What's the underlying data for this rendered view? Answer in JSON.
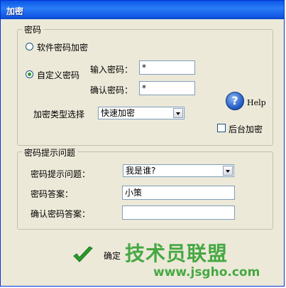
{
  "window": {
    "title": "加密"
  },
  "password_group": {
    "legend": "密码",
    "option_software": "软件密码加密",
    "option_custom": "自定义密码",
    "enter_password_label": "输入密码：",
    "enter_password_value": "*",
    "confirm_password_label": "确认密码：",
    "confirm_password_value": "*",
    "encrypt_type_label": "加密类型选择",
    "encrypt_type_value": "快速加密",
    "help_label": "Help",
    "background_encrypt_label": "后台加密"
  },
  "hint_group": {
    "legend": "密码提示问题",
    "question_label": "密码提示问题：",
    "question_value": "我是谁?",
    "answer_label": "密码答案：",
    "answer_value": "小策",
    "confirm_answer_label": "确认密码答案：",
    "confirm_answer_value": ""
  },
  "footer": {
    "ok_label": "确定"
  },
  "watermark": {
    "text": "技术员联盟",
    "url": "www.jsgho.com"
  },
  "colors": {
    "titlebar": "#0a58e6",
    "dialog_bg": "#ece9d8",
    "check_green": "#2a9d2a"
  }
}
